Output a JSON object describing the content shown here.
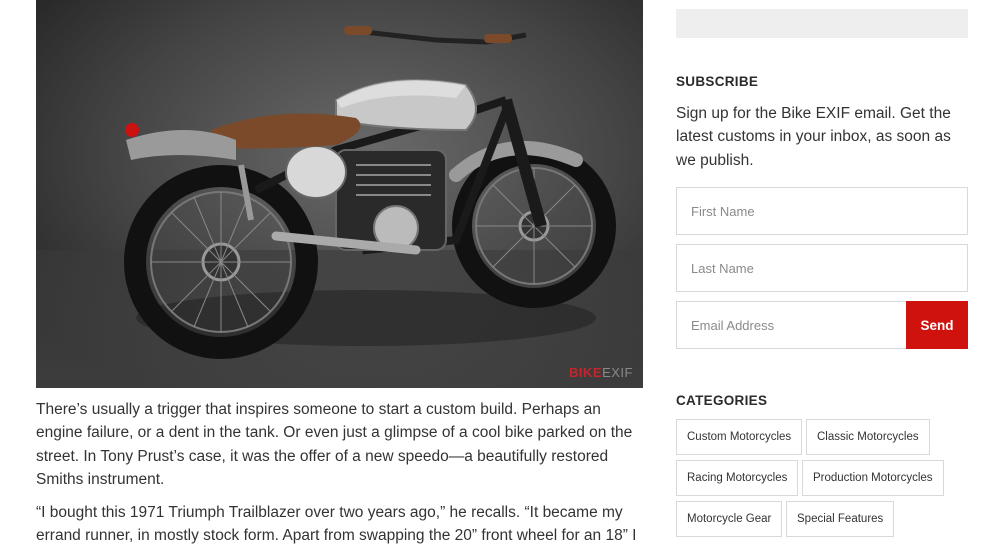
{
  "photo": {
    "alt_watermark_a": "BIKE",
    "alt_watermark_b": "EXIF"
  },
  "article": {
    "paragraphs": [
      "There’s usually a trigger that inspires someone to start a custom build. Perhaps an engine failure, or a dent in the tank. Or even just a glimpse of a cool bike parked on the street. In Tony Prust’s case, it was the offer of a new speedo—a beautifully restored Smiths instrument.",
      "“I bought this 1971 Triumph Trailblazer over two years ago,” he recalls. “It became my errand runner, in mostly stock form. Apart from swapping the 20” front wheel for an 18” I"
    ]
  },
  "sidebar": {
    "subscribe": {
      "heading": "SUBSCRIBE",
      "text": "Sign up for the Bike EXIF email. Get the latest customs in your inbox, as soon as we publish.",
      "first_name_placeholder": "First Name",
      "last_name_placeholder": "Last Name",
      "email_placeholder": "Email Address",
      "send_label": "Send"
    },
    "categories": {
      "heading": "CATEGORIES",
      "items": [
        "Custom Motorcycles",
        "Classic Motorcycles",
        "Racing Motorcycles",
        "Production Motorcycles",
        "Motorcycle Gear",
        "Special Features"
      ]
    }
  },
  "colors": {
    "accent": "#d0120e",
    "border": "#d9d9d9",
    "search_bg": "#eeeeee"
  }
}
